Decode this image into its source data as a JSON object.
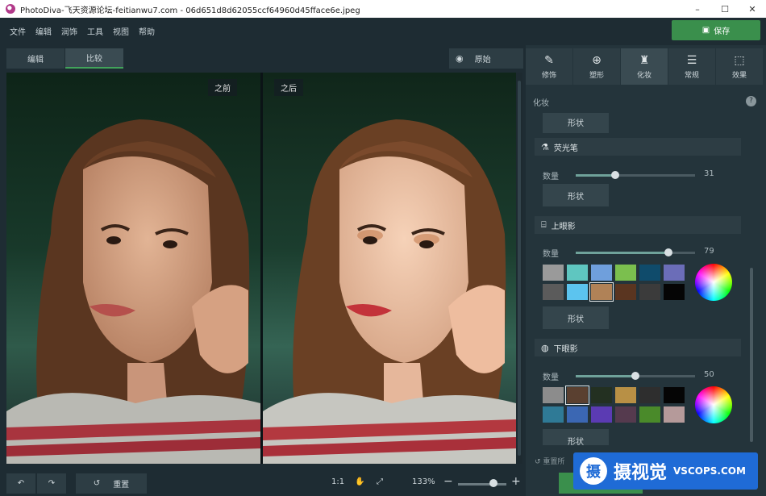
{
  "window": {
    "title": "PhotoDiva-飞天资源论坛-feitianwu7.com - 06d651d8d62055ccf64960d45fface6e.jpeg",
    "min": "–",
    "max": "☐",
    "close": "✕"
  },
  "menu": [
    "文件",
    "编辑",
    "润饰",
    "工具",
    "视图",
    "帮助"
  ],
  "save_label": "保存",
  "toolbar": {
    "edit": "编辑",
    "compare": "比较",
    "original": "原始"
  },
  "canvas": {
    "before": "之前",
    "after": "之后"
  },
  "bottom": {
    "reset": "重置",
    "one_to_one": "1:1",
    "zoom": "133%"
  },
  "tabs": [
    {
      "label": "修饰",
      "icon": "brush-icon"
    },
    {
      "label": "塑形",
      "icon": "shape-icon"
    },
    {
      "label": "化妆",
      "icon": "makeup-icon"
    },
    {
      "label": "常规",
      "icon": "sliders-icon"
    },
    {
      "label": "效果",
      "icon": "effects-icon"
    }
  ],
  "active_tab": "化妆",
  "panel": {
    "section_title": "化妆",
    "help": "?",
    "shape_label": "形状",
    "quantity_label": "数量",
    "highlighter": {
      "title": "荧光笔",
      "value": 31,
      "level": 0.33
    },
    "upper_shadow": {
      "title": "上眼影",
      "value": 79,
      "level": 0.78,
      "swatches": [
        "#9a9a9a",
        "#5fc6c0",
        "#6f9fdc",
        "#7bbf4e",
        "#0f4b6b",
        "#6b6db8",
        "#5b5b5b",
        "#5cc4ef",
        "#b08257",
        "#5a3520",
        "#3b3b3b",
        "#050505"
      ],
      "selected": 8
    },
    "lower_shadow": {
      "title": "下眼影",
      "value": 50,
      "level": 0.5,
      "swatches": [
        "#8c8c8c",
        "#5a4030",
        "#233021",
        "#b89045",
        "#2e2e2e",
        "#050505",
        "#2f7a96",
        "#3b67b3",
        "#5b3bb3",
        "#553a4e",
        "#4a8a2a",
        "#b59a9a"
      ],
      "selected": 1
    },
    "reset_label": "重置所"
  },
  "watermark": {
    "logo": "摄",
    "text": "摄视觉",
    "domain": "VSCOPS.COM"
  },
  "colors": {
    "accent": "#3a8f4c",
    "panel": "#24343b",
    "bg": "#1e2c33"
  }
}
